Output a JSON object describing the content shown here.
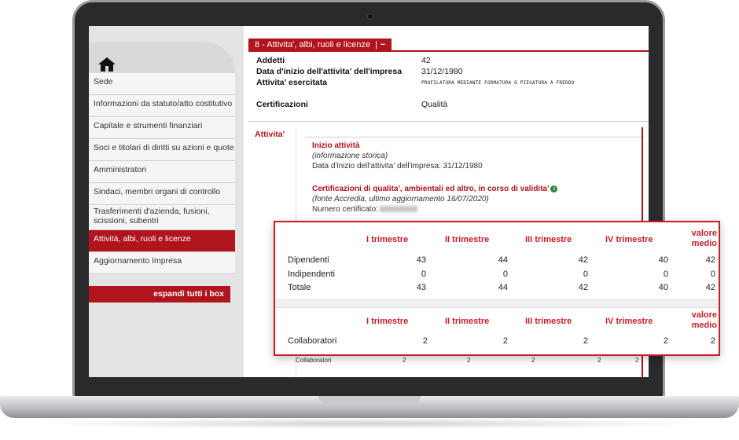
{
  "sidebar": {
    "items": [
      {
        "label": "Sede"
      },
      {
        "label": "Informazioni da statuto/atto costitutivo"
      },
      {
        "label": "Capitale e strumenti finanziari"
      },
      {
        "label": "Soci e titolari di diritti su azioni e quote"
      },
      {
        "label": "Amministratori"
      },
      {
        "label": "Sindaci, membri organi di controllo"
      },
      {
        "label": "Trasferimenti d'azienda, fusioni, scissioni, subentri"
      },
      {
        "label": "Attività, albi, ruoli e licenze"
      },
      {
        "label": "Aggiornamento Impresa"
      }
    ],
    "expand_button": "espandi tutti i box"
  },
  "tab": {
    "label": "8 - Attivita', albi, ruoli e licenze",
    "separator": "|",
    "collapse": "−"
  },
  "info": {
    "addetti_label": "Addetti",
    "addetti_value": "42",
    "inizio_label": "Data d'inizio dell'attivita' dell'impresa",
    "inizio_value": "31/12/1980",
    "esercitata_label": "Attivita' esercitata",
    "esercitata_value": "PROFILATURA MEDIANTE FORMATURA O PIEGATURA A FREDDO",
    "cert_label": "Certificazioni",
    "cert_value": "Qualità"
  },
  "section_label": "Attivita'",
  "detail": {
    "inizio_title": "Inizio attività",
    "storica": "(informazione storica)",
    "data_line": "Data d'inizio dell'attivita' dell'impresa: 31/12/1980",
    "cert_title": "Certificazioni di qualita', ambientali ed altro, in corso di validita'",
    "fonte": "(fonte Accredia, ultimo aggiornamento 16/07/2020)",
    "numero": "Numero certificato:"
  },
  "mini_row": {
    "label": "Collaboratori",
    "values": [
      "2",
      "2",
      "2",
      "2",
      "2"
    ]
  },
  "popup": {
    "headers": [
      "I trimestre",
      "II trimestre",
      "III trimestre",
      "IV trimestre",
      "valore",
      "medio"
    ],
    "rows": [
      {
        "label": "Dipendenti",
        "values": [
          "43",
          "44",
          "42",
          "40",
          "42"
        ]
      },
      {
        "label": "Indipendenti",
        "values": [
          "0",
          "0",
          "0",
          "0",
          "0"
        ]
      },
      {
        "label": "Totale",
        "values": [
          "43",
          "44",
          "42",
          "40",
          "42"
        ]
      }
    ],
    "collab": {
      "label": "Collaboratori",
      "values": [
        "2",
        "2",
        "2",
        "2",
        "2"
      ]
    }
  }
}
